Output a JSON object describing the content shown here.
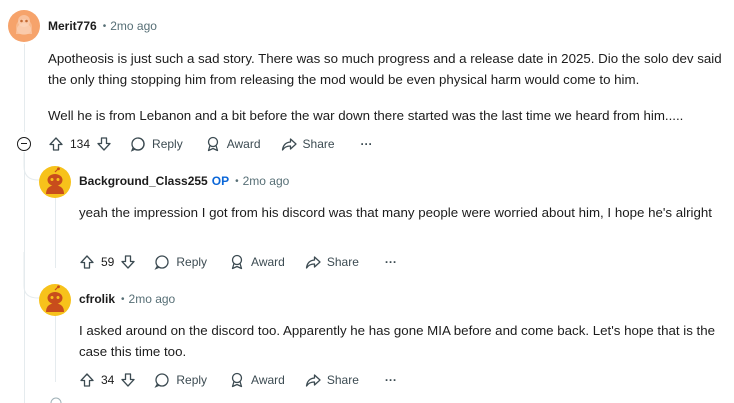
{
  "comments": [
    {
      "author": "Merit776",
      "time": "2mo ago",
      "paragraphs": [
        "Apotheosis is just such a sad story. There was so much progress and a release date in 2025. Dio the solo dev said the only thing stopping him from releasing the mod would be even physical harm would come to him.",
        "Well he is from Lebanon and a bit before the war down there started was the last time we heard from him....."
      ],
      "votes": "134",
      "actions": {
        "reply": "Reply",
        "award": "Award",
        "share": "Share",
        "more": "···"
      }
    },
    {
      "author": "Background_Class255",
      "op_badge": "OP",
      "time": "2mo ago",
      "paragraphs": [
        "yeah the impression I got from his discord was that many people were worried about him, I hope he's alright"
      ],
      "votes": "59",
      "actions": {
        "reply": "Reply",
        "award": "Award",
        "share": "Share",
        "more": "···"
      }
    },
    {
      "author": "cfrolik",
      "time": "2mo ago",
      "paragraphs": [
        "I asked around on the discord too. Apparently he has gone MIA before and come back. Let's hope that is the case this time too."
      ],
      "votes": "34",
      "actions": {
        "reply": "Reply",
        "award": "Award",
        "share": "Share",
        "more": "···"
      }
    }
  ],
  "colors": {
    "avatar_orange": "#f6a36b",
    "avatar_yellow": "#f7c21b",
    "op_blue": "#0a66d8"
  }
}
